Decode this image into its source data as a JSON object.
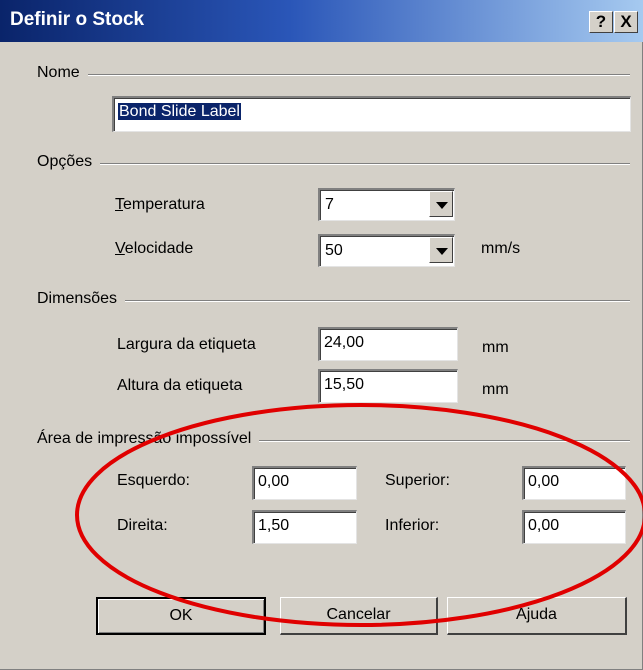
{
  "window": {
    "title": "Definir o Stock",
    "help_button": "?",
    "close_button": "X"
  },
  "nome": {
    "group_label": "Nome",
    "value": "Bond Slide Label"
  },
  "opcoes": {
    "group_label": "Opções",
    "temperatura": {
      "accel": "T",
      "rest": "emperatura",
      "value": "7"
    },
    "velocidade": {
      "accel": "V",
      "rest": "elocidade",
      "value": "50",
      "unit": "mm/s"
    }
  },
  "dimensoes": {
    "group_label": "Dimensões",
    "largura": {
      "label": "Largura da etiqueta",
      "value": "24,00",
      "unit": "mm"
    },
    "altura": {
      "label": "Altura da etiqueta",
      "value": "15,50",
      "unit": "mm"
    }
  },
  "area": {
    "group_label": "Área de impressão impossível",
    "esquerdo": {
      "label": "Esquerdo:",
      "value": "0,00"
    },
    "superior": {
      "label": "Superior:",
      "value": "0,00"
    },
    "direita": {
      "label": "Direita:",
      "value": "1,50"
    },
    "inferior": {
      "label": "Inferior:",
      "value": "0,00"
    }
  },
  "buttons": {
    "ok": "OK",
    "cancelar": "Cancelar",
    "ajuda": "Ajuda"
  },
  "colors": {
    "titlebar_start": "#0a246a",
    "dialog_face": "#d4d0c8",
    "annotation": "#e00000"
  }
}
